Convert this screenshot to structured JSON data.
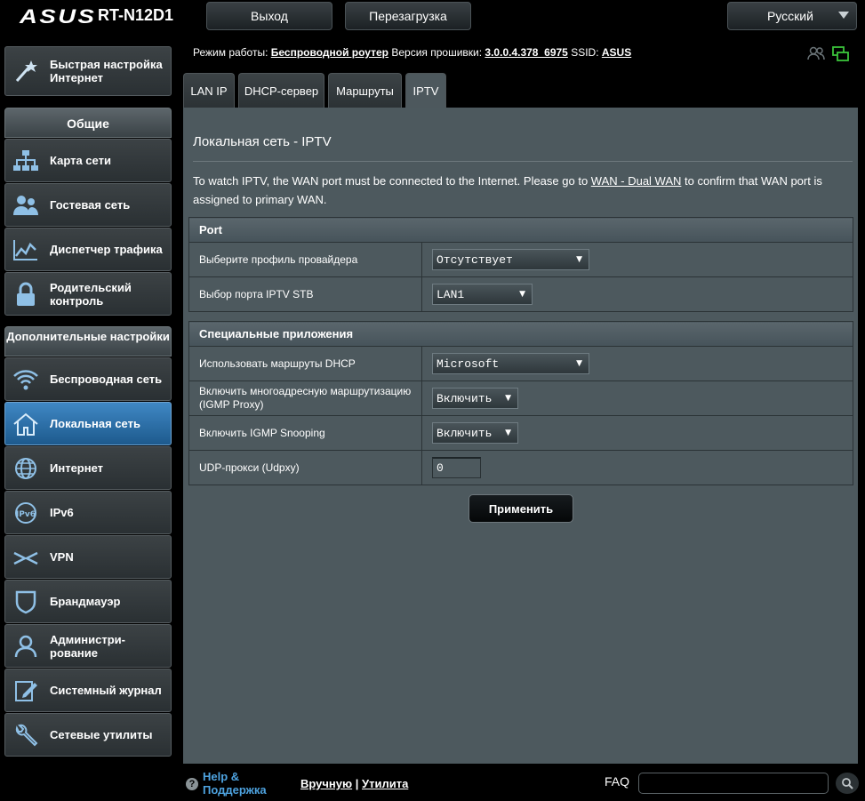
{
  "header": {
    "brand": "ASUS",
    "model": "RT-N12D1",
    "logout_label": "Выход",
    "reboot_label": "Перезагрузка",
    "language": "Русский"
  },
  "status": {
    "mode_label": "Режим работы:",
    "mode_value": "Беспроводной роутер",
    "fw_label": "Версия прошивки:",
    "fw_value": "3.0.0.4.378_6975",
    "ssid_label": "SSID:",
    "ssid_value": "ASUS"
  },
  "sidebar": {
    "quick_setup": "Быстрая настройка Интернет",
    "general_header": "Общие",
    "general": [
      {
        "label": "Карта сети",
        "icon": "network-map-icon"
      },
      {
        "label": "Гостевая сеть",
        "icon": "guest-network-icon"
      },
      {
        "label": "Диспетчер трафика",
        "icon": "traffic-manager-icon"
      },
      {
        "label": "Родительский контроль",
        "icon": "parental-control-icon"
      }
    ],
    "advanced_header": "Дополнительные настройки",
    "advanced": [
      {
        "label": "Беспроводная сеть",
        "icon": "wireless-icon"
      },
      {
        "label": "Локальная сеть",
        "icon": "lan-home-icon",
        "active": true
      },
      {
        "label": "Интернет",
        "icon": "globe-icon"
      },
      {
        "label": "IPv6",
        "icon": "ipv6-icon"
      },
      {
        "label": "VPN",
        "icon": "vpn-icon"
      },
      {
        "label": "Брандмауэр",
        "icon": "firewall-shield-icon"
      },
      {
        "label": "Администри-рование",
        "icon": "admin-user-icon"
      },
      {
        "label": "Системный журнал",
        "icon": "system-log-icon"
      },
      {
        "label": "Сетевые утилиты",
        "icon": "network-tools-icon"
      }
    ]
  },
  "tabs": [
    {
      "label": "LAN IP"
    },
    {
      "label": "DHCP-сервер"
    },
    {
      "label": "Маршруты"
    },
    {
      "label": "IPTV",
      "active": true
    }
  ],
  "page": {
    "title": "Локальная сеть - IPTV",
    "desc_before": "To watch IPTV, the WAN port must be connected to the Internet. Please go to ",
    "desc_link": "WAN - Dual WAN",
    "desc_after": " to confirm that WAN port is assigned to primary WAN."
  },
  "port_section": {
    "header": "Port",
    "rows": [
      {
        "label": "Выберите профиль провайдера",
        "value": "Отсутствует"
      },
      {
        "label": "Выбор порта IPTV STB",
        "value": "LAN1"
      }
    ]
  },
  "special_section": {
    "header": "Специальные приложения",
    "rows": [
      {
        "label": "Использовать маршруты DHCP",
        "value": "Microsoft"
      },
      {
        "label": "Включить многоадресную маршрутизацию (IGMP Proxy)",
        "value": "Включить"
      },
      {
        "label": "Включить IGMP Snooping",
        "value": "Включить"
      },
      {
        "label": "UDP-прокси (Udpxy)",
        "value": "0"
      }
    ]
  },
  "apply_label": "Применить",
  "footer": {
    "help_line1": "Help &",
    "help_line2": "Поддержка",
    "link_manual": "Вручную",
    "separator": "|",
    "link_utility": "Утилита",
    "faq_label": "FAQ"
  },
  "colors": {
    "panel": "#4d595e",
    "active_nav": "#2a6fa8",
    "help_blue": "#4ea3e0"
  }
}
